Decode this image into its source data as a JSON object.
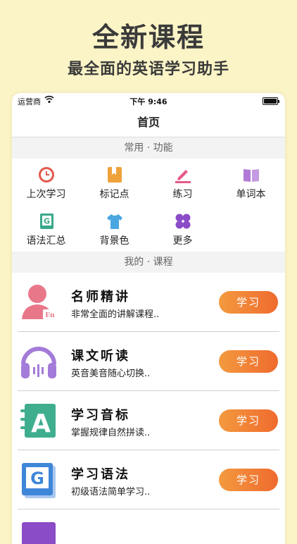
{
  "promo": {
    "title": "全新课程",
    "subtitle": "最全面的英语学习助手"
  },
  "status_bar": {
    "carrier": "运营商",
    "time": "下午 9:46"
  },
  "nav": {
    "title": "首页"
  },
  "sections": {
    "common": "常用 · 功能",
    "mine": "我的 · 课程"
  },
  "functions": [
    {
      "label": "上次学习",
      "icon": "clock-icon",
      "color": "#E4584B"
    },
    {
      "label": "标记点",
      "icon": "bookmark-icon",
      "color": "#F0A23A"
    },
    {
      "label": "练习",
      "icon": "pencil-icon",
      "color": "#E55A8A"
    },
    {
      "label": "单词本",
      "icon": "book-icon",
      "color": "#B07AD6"
    },
    {
      "label": "语法汇总",
      "icon": "grammar-book-icon",
      "color": "#3AA88A"
    },
    {
      "label": "背景色",
      "icon": "shirt-icon",
      "color": "#4AA6E0"
    },
    {
      "label": "更多",
      "icon": "clover-icon",
      "color": "#8B4CC7"
    }
  ],
  "courses": [
    {
      "title": "名师精讲",
      "desc": "非常全面的讲解课程..",
      "button": "学习",
      "icon": "teacher-icon",
      "color": "#E9778A"
    },
    {
      "title": "课文听读",
      "desc": "英音美音随心切换..",
      "button": "学习",
      "icon": "headphones-icon",
      "color": "#A37BD8"
    },
    {
      "title": "学习音标",
      "desc": "掌握规律自然拼读..",
      "button": "学习",
      "icon": "phonetics-icon",
      "color": "#3FAE8E"
    },
    {
      "title": "学习语法",
      "desc": "初级语法简单学习..",
      "button": "学习",
      "icon": "grammar-icon",
      "color": "#3E86D8"
    }
  ],
  "accent_color": "#F08A3A"
}
